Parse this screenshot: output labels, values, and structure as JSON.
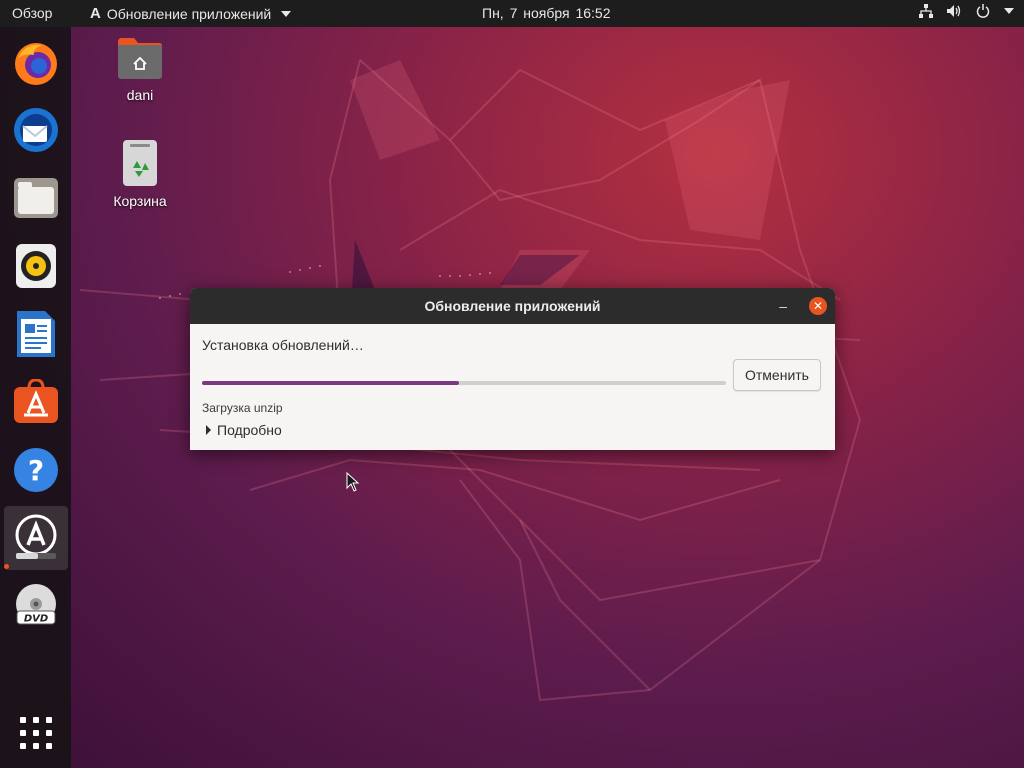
{
  "topbar": {
    "activities": "Обзор",
    "app_menu_label": "Обновление приложений",
    "clock": "Пн, 7 ноября  16:52",
    "tray_icons": [
      "network-icon",
      "volume-icon",
      "power-icon",
      "chevron-down-icon"
    ]
  },
  "dock": {
    "items": [
      "firefox-icon",
      "thunderbird-icon",
      "files-icon",
      "rhythmbox-icon",
      "libreoffice-writer-icon",
      "software-icon",
      "help-icon",
      "software-updater-icon",
      "dvd-icon"
    ],
    "active_item": "software-updater-icon",
    "show_apps": "show-applications-icon"
  },
  "desktop": {
    "home_label": "dani",
    "trash_label": "Корзина"
  },
  "dialog": {
    "title": "Обновление приложений",
    "minimize": "–",
    "close": "✕",
    "status": "Установка обновлений…",
    "progress": 0.49,
    "cancel_label": "Отменить",
    "substatus": "Загрузка unzip",
    "details_label": "Подробно"
  },
  "colors": {
    "accent": "#e95420",
    "progress": "#7b3a7e",
    "topbar": "#1d1d1d"
  }
}
